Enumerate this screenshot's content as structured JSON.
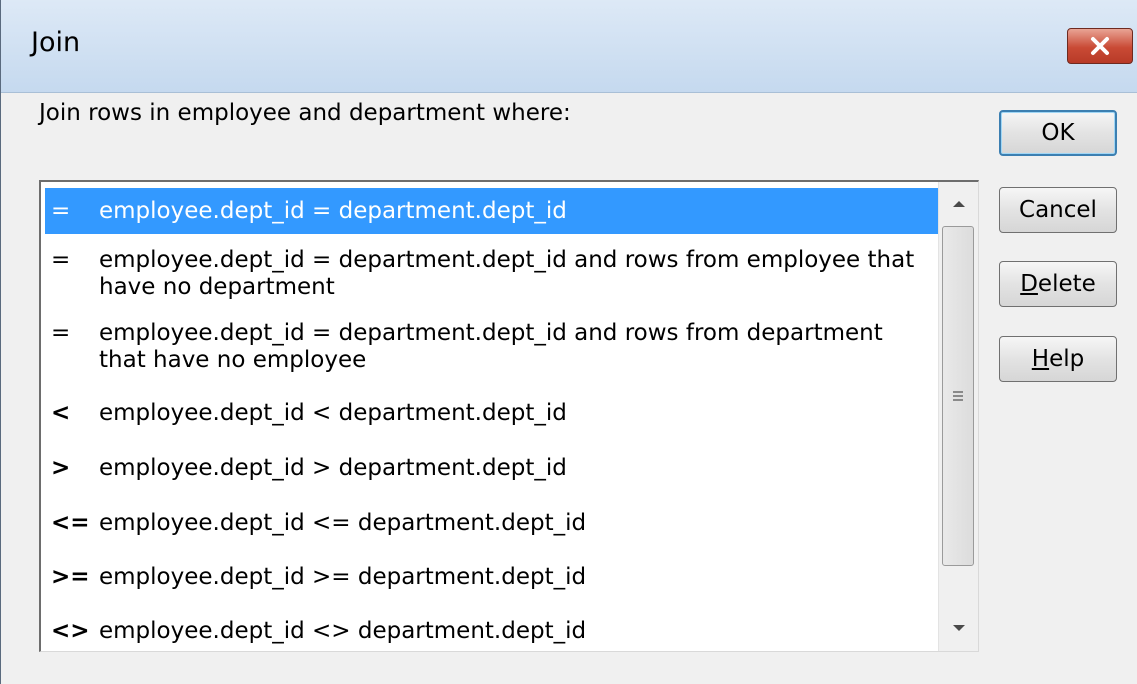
{
  "window": {
    "title": "Join",
    "close_icon": "close-icon"
  },
  "instruction": "Join rows in employee and department where:",
  "buttons": {
    "ok": "OK",
    "cancel": "Cancel",
    "delete": "Delete",
    "help": "Help"
  },
  "join_options": [
    {
      "op": "=",
      "text": "employee.dept_id = department.dept_id",
      "selected": true
    },
    {
      "op": "=",
      "text": "employee.dept_id = department.dept_id and rows from employee that have no department",
      "selected": false
    },
    {
      "op": "=",
      "text": "employee.dept_id = department.dept_id and rows from department that have no employee",
      "selected": false
    },
    {
      "op": "<",
      "text": "employee.dept_id < department.dept_id",
      "selected": false
    },
    {
      "op": ">",
      "text": "employee.dept_id > department.dept_id",
      "selected": false
    },
    {
      "op": "<=",
      "text": "employee.dept_id <= department.dept_id",
      "selected": false
    },
    {
      "op": ">=",
      "text": "employee.dept_id >= department.dept_id",
      "selected": false
    },
    {
      "op": "<>",
      "text": "employee.dept_id <> department.dept_id",
      "selected": false
    }
  ],
  "icons": {
    "scroll_up": "chevron-up-icon",
    "scroll_down": "chevron-down-icon",
    "thumb_grip": "grip-icon"
  }
}
